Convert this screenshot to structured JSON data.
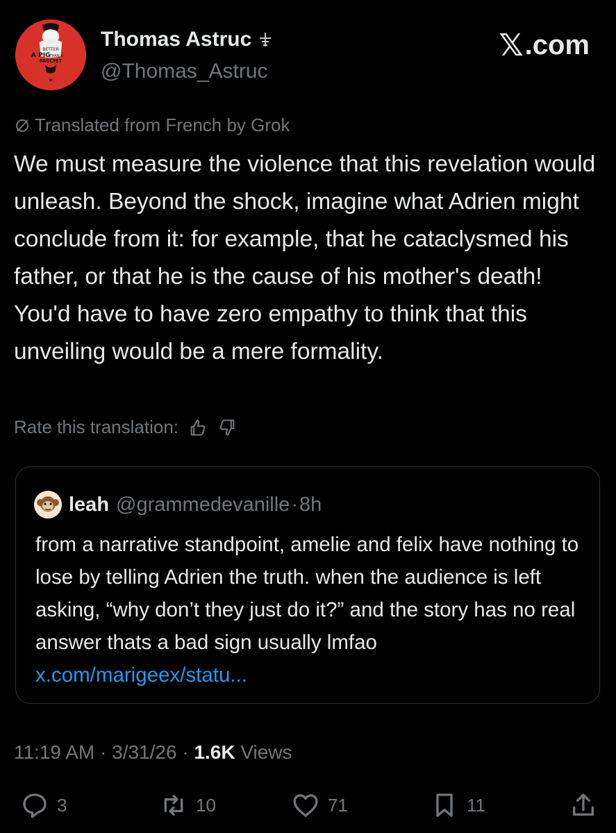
{
  "author": {
    "display_name": "Thomas Astruc",
    "handle": "@Thomas_Astruc",
    "badge_icon": "affiliate-badge-icon",
    "avatar_text": [
      "BETTER",
      "A PIG",
      "THAN A",
      "FASCIST"
    ]
  },
  "site_logo": {
    "glyph": "𝕏",
    "text": ".com"
  },
  "translation": {
    "label": "Translated from French by Grok",
    "rate_label": "Rate this translation:"
  },
  "tweet": {
    "paragraphs": [
      "We must measure the violence that this revelation would unleash. Beyond the shock, imagine what Adrien might conclude from it: for example, that he cataclysmed his father, or that he is the cause of his mother's death!",
      "You'd have to have zero empathy to think that this unveiling would be a mere formality."
    ]
  },
  "quote": {
    "name": "leah",
    "handle": "@grammedevanille",
    "dot": "·",
    "time": "8h",
    "text": "from a narrative standpoint, amelie and felix have nothing to lose by telling Adrien the truth. when the audience is left asking, “why don’t they just do it?” and the story has no real answer thats a bad sign usually lmfao ",
    "link": "x.com/marigeex/statu..."
  },
  "meta": {
    "time": "11:19 AM",
    "sep1": " · ",
    "date": "3/31/26",
    "sep2": " · ",
    "views_count": "1.6K",
    "views_label": " Views"
  },
  "actions": {
    "replies": "3",
    "reposts": "10",
    "likes": "71",
    "bookmarks": "11"
  },
  "colors": {
    "background": "#000000",
    "text_primary": "#e7e9ea",
    "text_secondary": "#71767b",
    "link": "#1d9bf0",
    "avatar_red": "#d8312a",
    "border": "#2f3336"
  }
}
